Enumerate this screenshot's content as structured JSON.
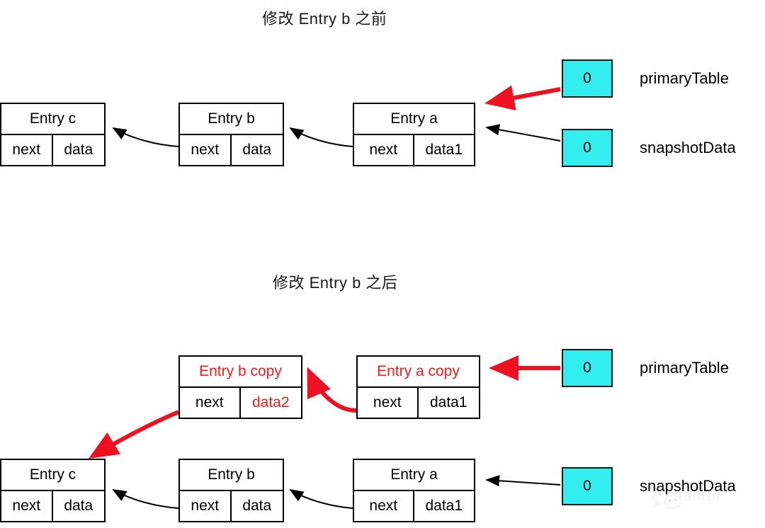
{
  "figure": {
    "sections": [
      {
        "id": "before",
        "title": "修改 Entry b 之前",
        "nodes": [
          {
            "id": "entry-c",
            "title": "Entry c",
            "next": "next",
            "data": "data",
            "title_color": "#000000",
            "data_color": "#000000"
          },
          {
            "id": "entry-b",
            "title": "Entry b",
            "next": "next",
            "data": "data",
            "title_color": "#000000",
            "data_color": "#000000"
          },
          {
            "id": "entry-a",
            "title": "Entry a",
            "next": "next",
            "data": "data1",
            "title_color": "#000000",
            "data_color": "#000000"
          }
        ],
        "pointers": [
          {
            "id": "primary-table",
            "value": "0",
            "label": "primaryTable",
            "arrow_color": "#ee1122"
          },
          {
            "id": "snapshot-data",
            "value": "0",
            "label": "snapshotData",
            "arrow_color": "#000000"
          }
        ]
      },
      {
        "id": "after",
        "title": "修改 Entry b 之后",
        "copy_nodes": [
          {
            "id": "entry-b-copy",
            "title": "Entry b copy",
            "next": "next",
            "data": "data2",
            "title_color": "#ff1a1a",
            "data_color": "#ff1a1a"
          },
          {
            "id": "entry-a-copy",
            "title": "Entry a copy",
            "next": "next",
            "data": "data1",
            "title_color": "#ff1a1a",
            "data_color": "#000000"
          }
        ],
        "nodes": [
          {
            "id": "entry-c-after",
            "title": "Entry c",
            "next": "next",
            "data": "data",
            "title_color": "#000000",
            "data_color": "#000000"
          },
          {
            "id": "entry-b-after",
            "title": "Entry b",
            "next": "next",
            "data": "data",
            "title_color": "#000000",
            "data_color": "#000000"
          },
          {
            "id": "entry-a-after",
            "title": "Entry a",
            "next": "next",
            "data": "data1",
            "title_color": "#000000",
            "data_color": "#000000"
          }
        ],
        "pointers": [
          {
            "id": "primary-table-after",
            "value": "0",
            "label": "primaryTable",
            "arrow_color": "#ee1122"
          },
          {
            "id": "snapshot-data-after",
            "value": "0",
            "label": "snapshotData",
            "arrow_color": "#000000"
          }
        ]
      }
    ],
    "colors": {
      "pointer_fill": "#33eeee",
      "copy_accent": "#ff1a1a",
      "arrow_red": "#ee1122",
      "arrow_black": "#000000",
      "stroke": "#000000",
      "background": "#ffffff"
    },
    "watermark": {
      "text": "fanrui"
    }
  }
}
